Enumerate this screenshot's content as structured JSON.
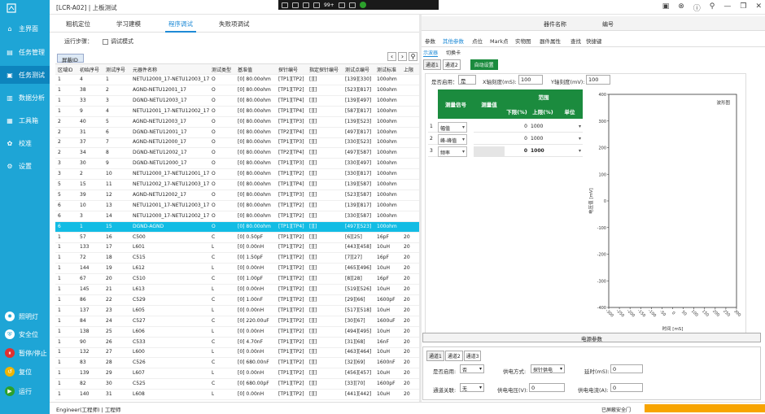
{
  "sidebar": {
    "items": [
      {
        "label": "主界面",
        "icon": "home-icon"
      },
      {
        "label": "任务管理",
        "icon": "task-icon"
      },
      {
        "label": "任务测试",
        "icon": "test-icon"
      },
      {
        "label": "数据分析",
        "icon": "chart-icon"
      },
      {
        "label": "工具箱",
        "icon": "toolbox-icon"
      },
      {
        "label": "校准",
        "icon": "calibrate-icon"
      },
      {
        "label": "设置",
        "icon": "settings-icon"
      }
    ],
    "bottom": [
      {
        "label": "照明灯",
        "icon": "lamp-icon",
        "color": "#ffffff"
      },
      {
        "label": "安全位",
        "icon": "shield-icon",
        "color": "#ffffff"
      },
      {
        "label": "暂停/停止",
        "icon": "pause-icon",
        "color": "#e03030"
      },
      {
        "label": "复位",
        "icon": "reset-icon",
        "color": "#f0b400"
      },
      {
        "label": "运行",
        "icon": "run-icon",
        "color": "#2ca02c"
      }
    ]
  },
  "titlebar": {
    "title": "[LCR-A02] | 上板测试"
  },
  "tray": {
    "text": "99+"
  },
  "tabs": [
    "粗机定位",
    "学习建模",
    "程序调试",
    "失败项调试"
  ],
  "steps": {
    "label": "运行步骤：",
    "checkbox": "调试模式"
  },
  "sheet_tab": "屏蔽ID",
  "grid": {
    "headers": [
      "区域ID",
      "初始序号",
      "测试序号",
      "元器件名称",
      "测试类型",
      "基准值",
      "探针编号",
      "指定探针编号",
      "测试点编号",
      "测试标准",
      "上限"
    ],
    "rows": [
      [
        "1",
        "4",
        "1",
        "NETU12000_17-NETU12003_17",
        "O",
        "[0]  80.00ohm",
        "[TP1][TP2]",
        "[][]",
        "[139][330]",
        "100ohm",
        ""
      ],
      [
        "1",
        "38",
        "2",
        "AGND-NETU12001_17",
        "O",
        "[0]  80.00ohm",
        "[TP1][TP2]",
        "[][]",
        "[523][817]",
        "100ohm",
        ""
      ],
      [
        "1",
        "33",
        "3",
        "DGND-NETU12003_17",
        "O",
        "[0]  80.00ohm",
        "[TP1][TP4]",
        "[][]",
        "[139][497]",
        "100ohm",
        ""
      ],
      [
        "1",
        "9",
        "4",
        "NETU12001_17-NETU12002_17",
        "O",
        "[0]  80.00ohm",
        "[TP1][TP4]",
        "[][]",
        "[587][817]",
        "100ohm",
        ""
      ],
      [
        "2",
        "40",
        "5",
        "AGND-NETU12003_17",
        "O",
        "[0]  80.00ohm",
        "[TP1][TP3]",
        "[][]",
        "[139][523]",
        "100ohm",
        ""
      ],
      [
        "2",
        "31",
        "6",
        "DGND-NETU12001_17",
        "O",
        "[0]  80.00ohm",
        "[TP2][TP4]",
        "[][]",
        "[497][817]",
        "100ohm",
        ""
      ],
      [
        "2",
        "37",
        "7",
        "AGND-NETU12000_17",
        "O",
        "[0]  80.00ohm",
        "[TP1][TP3]",
        "[][]",
        "[330][523]",
        "100ohm",
        ""
      ],
      [
        "2",
        "34",
        "8",
        "DGND-NETU12002_17",
        "O",
        "[0]  80.00ohm",
        "[TP2][TP4]",
        "[][]",
        "[497][587]",
        "100ohm",
        ""
      ],
      [
        "3",
        "30",
        "9",
        "DGND-NETU12000_17",
        "O",
        "[0]  80.00ohm",
        "[TP1][TP3]",
        "[][]",
        "[330][497]",
        "100ohm",
        ""
      ],
      [
        "3",
        "2",
        "10",
        "NETU12000_17-NETU12001_17",
        "O",
        "[0]  80.00ohm",
        "[TP1][TP2]",
        "[][]",
        "[330][817]",
        "100ohm",
        ""
      ],
      [
        "5",
        "15",
        "11",
        "NETU12002_17-NETU12003_17",
        "O",
        "[0]  80.00ohm",
        "[TP1][TP4]",
        "[][]",
        "[139][587]",
        "100ohm",
        ""
      ],
      [
        "5",
        "39",
        "12",
        "AGND-NETU12002_17",
        "O",
        "[0]  80.00ohm",
        "[TP1][TP3]",
        "[][]",
        "[523][587]",
        "100ohm",
        ""
      ],
      [
        "6",
        "10",
        "13",
        "NETU12001_17-NETU12003_17",
        "O",
        "[0]  80.00ohm",
        "[TP1][TP2]",
        "[][]",
        "[139][817]",
        "100ohm",
        ""
      ],
      [
        "6",
        "3",
        "14",
        "NETU12000_17-NETU12002_17",
        "O",
        "[0]  80.00ohm",
        "[TP1][TP2]",
        "[][]",
        "[330][587]",
        "100ohm",
        ""
      ],
      [
        "6",
        "1",
        "15",
        "DGND-AGND",
        "O",
        "[0]  80.00ohm",
        "[TP1][TP4]",
        "[][]",
        "[497][523]",
        "100ohm",
        ""
      ],
      [
        "1",
        "57",
        "16",
        "C500",
        "C",
        "[0]  0.50pF",
        "[TP1][TP2]",
        "[][]",
        "[6][25]",
        "16pF",
        "20"
      ],
      [
        "1",
        "133",
        "17",
        "L601",
        "L",
        "[0]  0.00nH",
        "[TP1][TP2]",
        "[][]",
        "[443][458]",
        "10uH",
        "20"
      ],
      [
        "1",
        "72",
        "18",
        "C515",
        "C",
        "[0]  1.50pF",
        "[TP1][TP2]",
        "[][]",
        "[7][27]",
        "16pF",
        "20"
      ],
      [
        "1",
        "144",
        "19",
        "L612",
        "L",
        "[0]  0.00nH",
        "[TP1][TP2]",
        "[][]",
        "[465][496]",
        "10uH",
        "20"
      ],
      [
        "1",
        "67",
        "20",
        "C510",
        "C",
        "[0]  1.00pF",
        "[TP1][TP2]",
        "[][]",
        "[8][28]",
        "16pF",
        "20"
      ],
      [
        "1",
        "145",
        "21",
        "L613",
        "L",
        "[0]  0.00nH",
        "[TP1][TP2]",
        "[][]",
        "[519][526]",
        "10uH",
        "20"
      ],
      [
        "1",
        "86",
        "22",
        "C529",
        "C",
        "[0]  1.00nF",
        "[TP1][TP2]",
        "[][]",
        "[29][66]",
        "1600pF",
        "20"
      ],
      [
        "1",
        "137",
        "23",
        "L605",
        "L",
        "[0]  0.00nH",
        "[TP1][TP2]",
        "[][]",
        "[517][518]",
        "10uH",
        "20"
      ],
      [
        "1",
        "84",
        "24",
        "C527",
        "C",
        "[0]  220.00uF",
        "[TP1][TP2]",
        "[][]",
        "[30][67]",
        "1600uF",
        "20"
      ],
      [
        "1",
        "138",
        "25",
        "L606",
        "L",
        "[0]  0.00nH",
        "[TP1][TP2]",
        "[][]",
        "[494][495]",
        "10uH",
        "20"
      ],
      [
        "1",
        "90",
        "26",
        "C533",
        "C",
        "[0]  4.70nF",
        "[TP1][TP2]",
        "[][]",
        "[31][68]",
        "16nF",
        "20"
      ],
      [
        "1",
        "132",
        "27",
        "L600",
        "L",
        "[0]  0.00nH",
        "[TP1][TP2]",
        "[][]",
        "[463][464]",
        "10uH",
        "20"
      ],
      [
        "1",
        "83",
        "28",
        "C526",
        "C",
        "[0]  680.00nF",
        "[TP1][TP2]",
        "[][]",
        "[32][69]",
        "1600nF",
        "20"
      ],
      [
        "1",
        "139",
        "29",
        "L607",
        "L",
        "[0]  0.00nH",
        "[TP1][TP2]",
        "[][]",
        "[456][457]",
        "10uH",
        "20"
      ],
      [
        "1",
        "82",
        "30",
        "C525",
        "C",
        "[0]  680.00pF",
        "[TP1][TP2]",
        "[][]",
        "[33][70]",
        "1600pF",
        "20"
      ],
      [
        "1",
        "140",
        "31",
        "L608",
        "L",
        "[0]  0.00nH",
        "[TP1][TP2]",
        "[][]",
        "[441][442]",
        "10uH",
        "20"
      ]
    ],
    "selected_row": 14
  },
  "right": {
    "head": {
      "name": "器件名称",
      "number": "编号"
    },
    "tabs": [
      "参数",
      "其他参数",
      "点位",
      "Mark点",
      "实物图",
      "器件属性",
      "查找",
      "快捷键"
    ],
    "active_tab": 1,
    "subtabs": [
      "示波器",
      "切换卡"
    ],
    "channel_tabs": [
      "通道1",
      "通道2"
    ],
    "auto_btn": "自动设置",
    "enable_label": "是否启用：",
    "enable_value": "是",
    "xscale_label": "X轴刻度(mS):",
    "xscale_value": "100",
    "yscale_label": "Y轴刻度(mV):",
    "yscale_value": "100",
    "meas_headers": {
      "signal": "测量信号",
      "value": "测量值",
      "range": "范围",
      "lower": "下限(%)",
      "upper": "上限(%)",
      "unit": "单位"
    },
    "meas_rows": [
      {
        "n": "1",
        "signal": "幅值",
        "value": "",
        "lower": "0",
        "upper": "1000",
        "unit": ""
      },
      {
        "n": "2",
        "signal": "峰-峰值",
        "value": "",
        "lower": "0",
        "upper": "1000",
        "unit": ""
      },
      {
        "n": "3",
        "signal": "频率",
        "value": "",
        "lower": "0",
        "upper": "1000",
        "unit": ""
      }
    ],
    "power_btn": "电源参数",
    "ps_tabs": [
      "通道1",
      "通道2",
      "通道3"
    ],
    "ps_enable_label": "是否启用:",
    "ps_enable_value": "否",
    "ps_mode_label": "供电方式:",
    "ps_mode_value": "探针供电",
    "ps_delay_label": "延时(mS):",
    "ps_delay_value": "0",
    "ps_assoc_label": "通道关联:",
    "ps_assoc_value": "无",
    "ps_volt_label": "供电电压(V):",
    "ps_volt_value": "0",
    "ps_curr_label": "供电电流(A):",
    "ps_curr_value": "0"
  },
  "chart_data": {
    "type": "line",
    "title": "波形图",
    "xlabel": "时间 [mS]",
    "ylabel": "电压值 [mV]",
    "xlim": [
      -300,
      300
    ],
    "ylim": [
      -400,
      400
    ],
    "xticks": [
      -300,
      -250,
      -200,
      -150,
      -100,
      -50,
      0,
      50,
      100,
      150,
      200,
      250,
      300
    ],
    "yticks": [
      -400,
      -300,
      -200,
      -100,
      0,
      100,
      200,
      300,
      400
    ],
    "series": []
  },
  "status": {
    "user": "Engineer(工程师)  |  工程师",
    "conn": "已屏蔽安全门"
  }
}
